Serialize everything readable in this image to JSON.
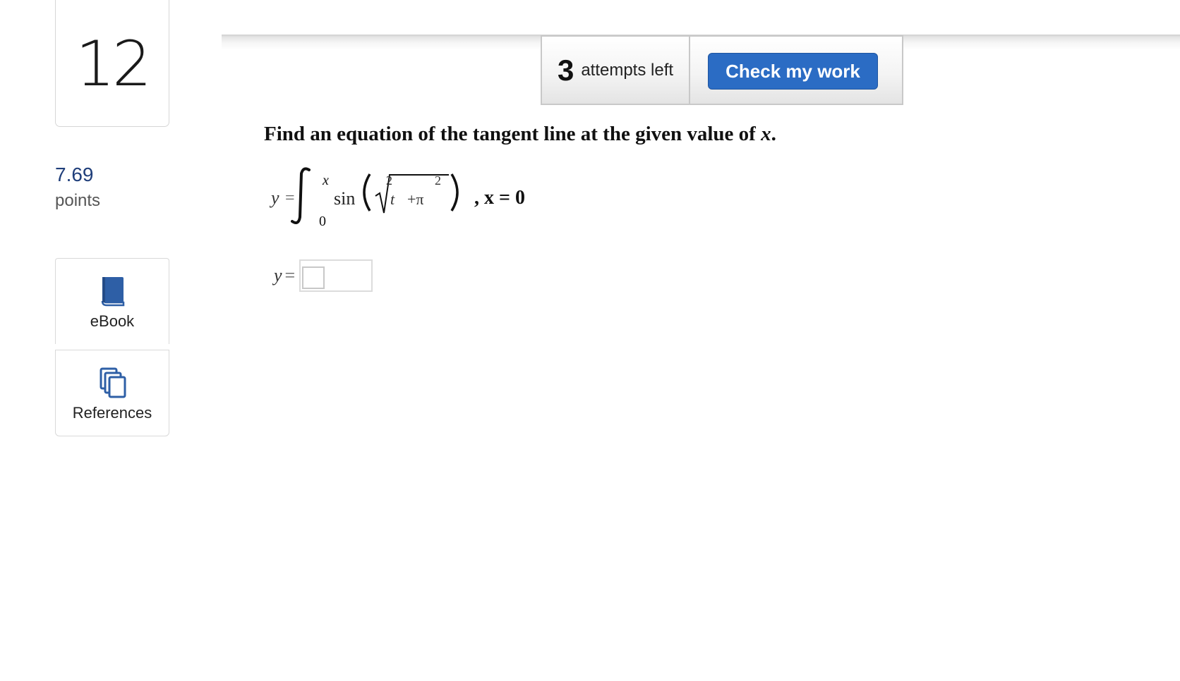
{
  "question": {
    "number": "12",
    "points_value": "7.69",
    "points_label": "points"
  },
  "sidebar": {
    "ebook_label": "eBook",
    "references_label": "References"
  },
  "toolbar": {
    "attempts_count": "3",
    "attempts_text": "attempts left",
    "check_label": "Check my work"
  },
  "problem": {
    "prompt_text": "Find an equation of the tangent line at the given value of",
    "prompt_var": "x",
    "prompt_end": ".",
    "equation": {
      "lhs": "y",
      "eq": "=",
      "upper_limit": "x",
      "lower_limit": "0",
      "func": "sin",
      "var": "t",
      "exp_1": "2",
      "plus_pi": "+π",
      "exp_2": "2",
      "condition": ", x = 0"
    },
    "answer_lhs": "y",
    "answer_eq": "="
  },
  "colors": {
    "accent_blue": "#2b6cc4",
    "points_blue": "#1f3e7a",
    "icon_blue": "#2e5fa6"
  },
  "icons": {
    "ebook": "book-icon",
    "references": "copy-pages-icon"
  }
}
